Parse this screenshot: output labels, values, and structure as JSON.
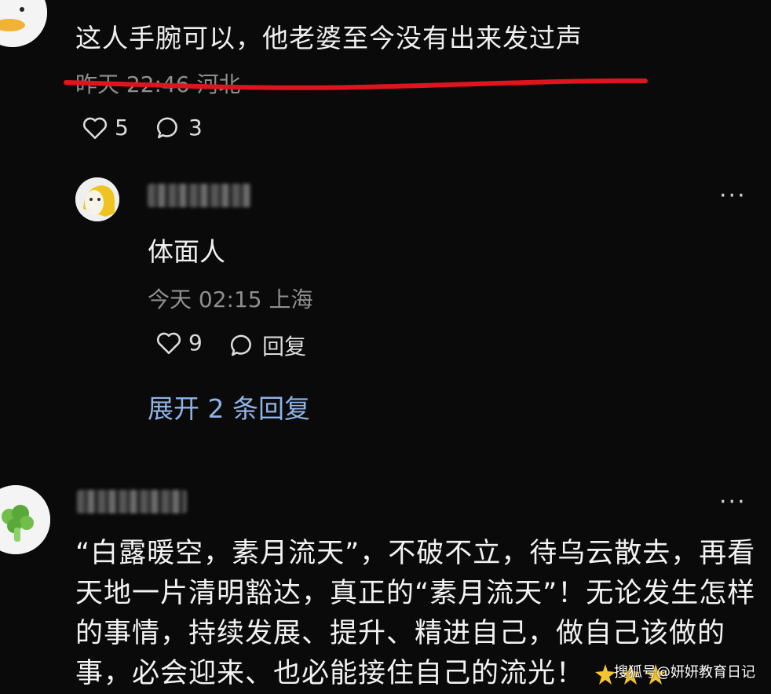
{
  "comment1": {
    "text": "这人手腕可以，他老婆至今没有出来发过声",
    "meta": "昨天 22:46 河北",
    "likes": "5",
    "replies": "3"
  },
  "reply1": {
    "text": "体面人",
    "meta": "今天 02:15 上海",
    "likes": "9",
    "reply_label": "回复",
    "more_label": "···"
  },
  "expand_label": "展开 2 条回复",
  "comment2": {
    "more_label": "···",
    "text": "“白露暖空，素月流天”，不破不立，待乌云散去，再看天地一片清明豁达，真正的“素月流天”！无论发生怎样的事情，持续发展、提升、精进自己，做自己该做的事，必会迎来、也必能接住自己的流光！"
  },
  "watermark": "搜狐号@妍妍教育日记",
  "colors": {
    "background": "#0a0a0a",
    "link": "#8fb3e6",
    "annotation_red": "#e0141e",
    "muted": "#8f8f8f"
  }
}
